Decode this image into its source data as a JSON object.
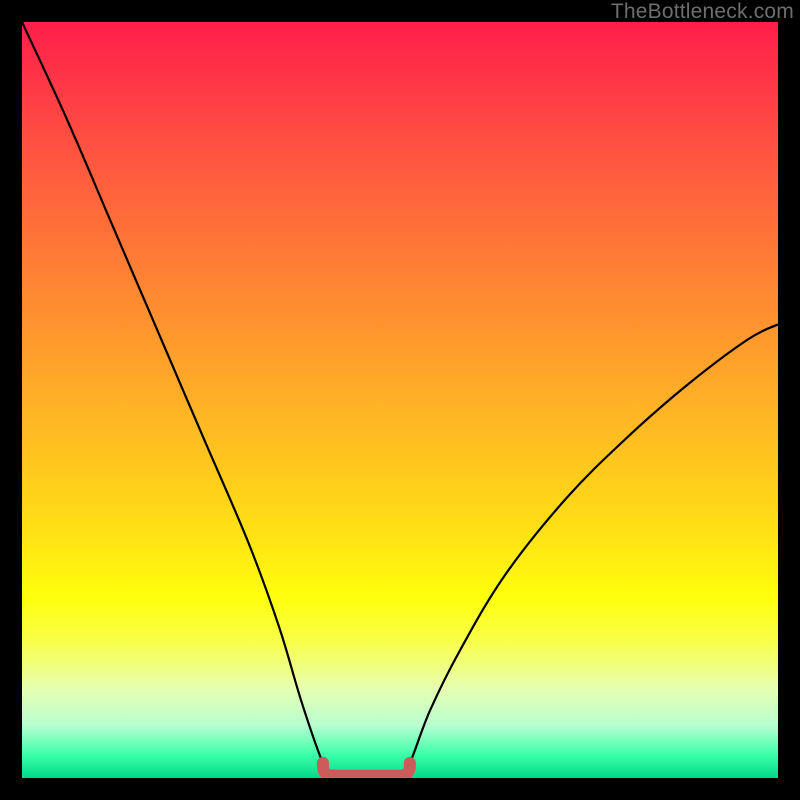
{
  "watermark": "TheBottleneck.com",
  "chart_data": {
    "type": "line",
    "title": "",
    "xlabel": "",
    "ylabel": "",
    "xlim": [
      0,
      100
    ],
    "ylim": [
      0,
      100
    ],
    "curve_left": {
      "comment": "left descending arm of the V; y is height from bottom (0=bottom, 100=top)",
      "x": [
        0,
        6,
        12,
        18,
        24,
        30,
        34,
        37,
        39.8,
        41
      ],
      "y": [
        100,
        87,
        73,
        59,
        45,
        31,
        20,
        10,
        2.0,
        0.8
      ]
    },
    "curve_right": {
      "comment": "right ascending arm of the V",
      "x": [
        50,
        51.3,
        54,
        58,
        64,
        72,
        80,
        88,
        96,
        100
      ],
      "y": [
        0.8,
        2.0,
        9,
        17,
        27,
        37,
        45,
        52,
        58,
        60
      ]
    },
    "flat_bottom": {
      "comment": "short flat bottom connecting the two arms",
      "x": [
        41,
        50
      ],
      "y": [
        0.8,
        0.8
      ]
    },
    "annotation_bracket": {
      "comment": "thick soft-red rounded bracket highlighting the minimum",
      "color": "#cc5c5c",
      "left_x": 39.8,
      "right_x": 51.3,
      "top_y": 2.0,
      "bottom_y": 0.3
    }
  }
}
